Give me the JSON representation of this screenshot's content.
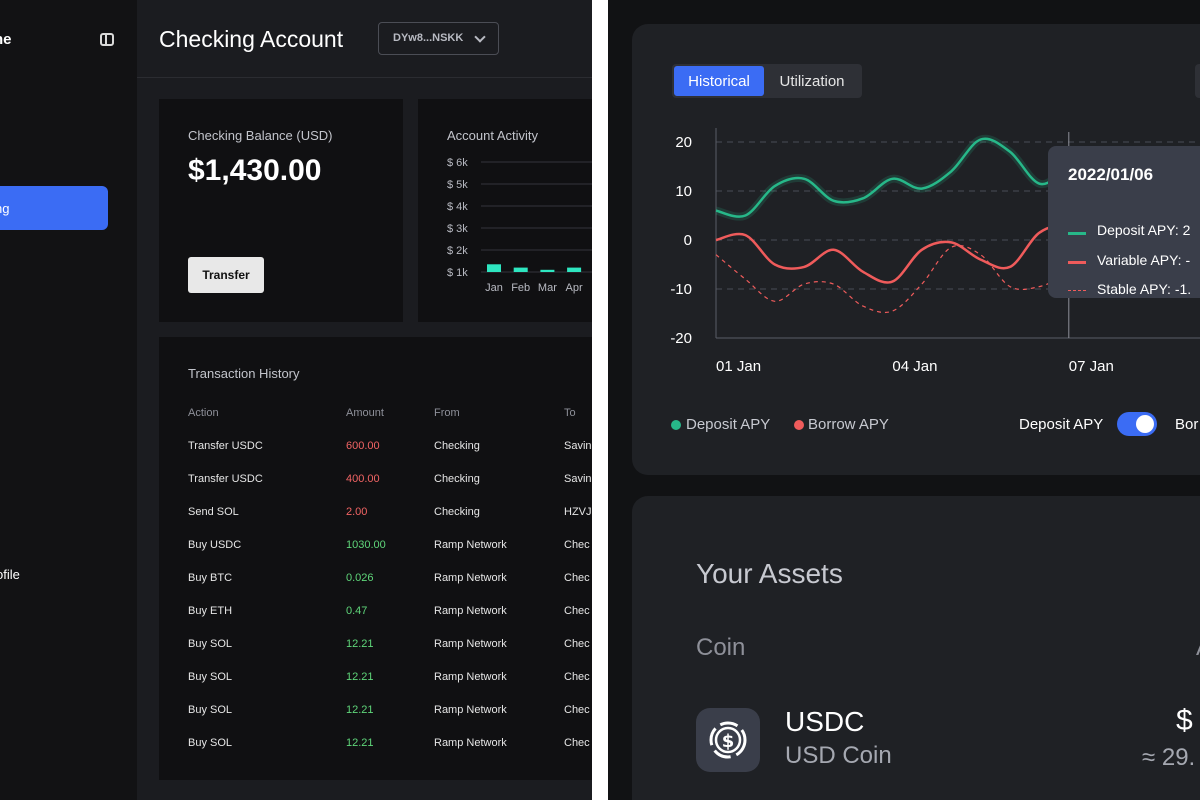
{
  "left_app": {
    "sidebar": {
      "brand_partial": "ne",
      "active_item_partial": "ng",
      "profile_partial": "ofile"
    },
    "header": {
      "title": "Checking Account",
      "wallet_label": "DYw8...NSKK"
    },
    "balance_card": {
      "label": "Checking Balance (USD)",
      "value": "$1,430.00",
      "transfer_label": "Transfer"
    },
    "activity_card": {
      "title": "Account Activity",
      "chart_data": {
        "type": "bar",
        "title": "Account Activity",
        "y_ticks": [
          "$ 6k",
          "$ 5k",
          "$ 4k",
          "$ 3k",
          "$ 2k",
          "$ 1k"
        ],
        "ylim": [
          1000,
          6000
        ],
        "categories": [
          "Jan",
          "Feb",
          "Mar",
          "Apr"
        ],
        "values": [
          1350,
          1200,
          1100,
          1200
        ],
        "color": "#2ee6c0"
      }
    },
    "transactions": {
      "title": "Transaction History",
      "columns": [
        "Action",
        "Amount",
        "From",
        "To"
      ],
      "rows": [
        {
          "action": "Transfer USDC",
          "amount": "600.00",
          "kind": "neg",
          "from": "Checking",
          "to": "Savin"
        },
        {
          "action": "Transfer USDC",
          "amount": "400.00",
          "kind": "neg",
          "from": "Checking",
          "to": "Savin"
        },
        {
          "action": "Send SOL",
          "amount": "2.00",
          "kind": "neg",
          "from": "Checking",
          "to": "HZVJ"
        },
        {
          "action": "Buy USDC",
          "amount": "1030.00",
          "kind": "pos",
          "from": "Ramp Network",
          "to": "Chec"
        },
        {
          "action": "Buy BTC",
          "amount": "0.026",
          "kind": "pos",
          "from": "Ramp Network",
          "to": "Chec"
        },
        {
          "action": "Buy ETH",
          "amount": "0.47",
          "kind": "pos",
          "from": "Ramp Network",
          "to": "Chec"
        },
        {
          "action": "Buy SOL",
          "amount": "12.21",
          "kind": "pos",
          "from": "Ramp Network",
          "to": "Chec"
        },
        {
          "action": "Buy SOL",
          "amount": "12.21",
          "kind": "pos",
          "from": "Ramp Network",
          "to": "Chec"
        },
        {
          "action": "Buy SOL",
          "amount": "12.21",
          "kind": "pos",
          "from": "Ramp Network",
          "to": "Chec"
        },
        {
          "action": "Buy SOL",
          "amount": "12.21",
          "kind": "pos",
          "from": "Ramp Network",
          "to": "Chec"
        }
      ]
    }
  },
  "right_app": {
    "tabs": [
      "Historical",
      "Utilization"
    ],
    "active_tab": "Historical",
    "tooltip": {
      "date": "2022/01/06",
      "lines": [
        "Deposit APY: 2",
        "Variable APY: -",
        "Stable APY: -1."
      ]
    },
    "legend": [
      "Deposit APY",
      "Borrow APY"
    ],
    "toggle_label": "Deposit APY",
    "toggle_on": true,
    "toggle2_label_partial": "Bor",
    "chart_data": {
      "type": "line",
      "x_ticks": [
        "01 Jan",
        "04 Jan",
        "07 Jan"
      ],
      "y_ticks": [
        "20",
        "10",
        "0",
        "-10",
        "-20"
      ],
      "ylim": [
        -20,
        22
      ],
      "x": [
        0,
        0.5,
        1,
        1.5,
        2,
        2.5,
        3,
        3.5,
        4,
        4.5,
        5,
        5.5,
        6,
        6.5,
        7,
        7.5
      ],
      "series": [
        {
          "name": "Deposit APY",
          "color": "#27b889",
          "style": "solid",
          "values": [
            6,
            5,
            11,
            12.5,
            8,
            8.5,
            12.5,
            10.5,
            14,
            20.5,
            18,
            11.5,
            14,
            12,
            11.5,
            12
          ]
        },
        {
          "name": "Variable APY",
          "color": "#ef5b5b",
          "style": "solid",
          "values": [
            0,
            1,
            -5,
            -5.5,
            -2,
            -6.5,
            -8.5,
            -2,
            -0.5,
            -4,
            -5.5,
            1.5,
            3,
            1,
            2,
            1
          ]
        },
        {
          "name": "Stable APY",
          "color": "#ef5b5b",
          "style": "dashed",
          "values": [
            -3,
            -8,
            -12.5,
            -9,
            -9,
            -13.5,
            -14.5,
            -9,
            -1.5,
            -3,
            -9.5,
            -9.5,
            -7,
            -5,
            -5,
            -5
          ]
        }
      ],
      "hover_x": 6,
      "grid": "dashed-horizontal"
    },
    "assets": {
      "title": "Your Assets",
      "column_coin": "Coin",
      "column_right_partial": "A",
      "coin_name": "USDC",
      "coin_full": "USD Coin",
      "amount_partial": "$",
      "amount_sub_partial": "≈ 29."
    }
  }
}
